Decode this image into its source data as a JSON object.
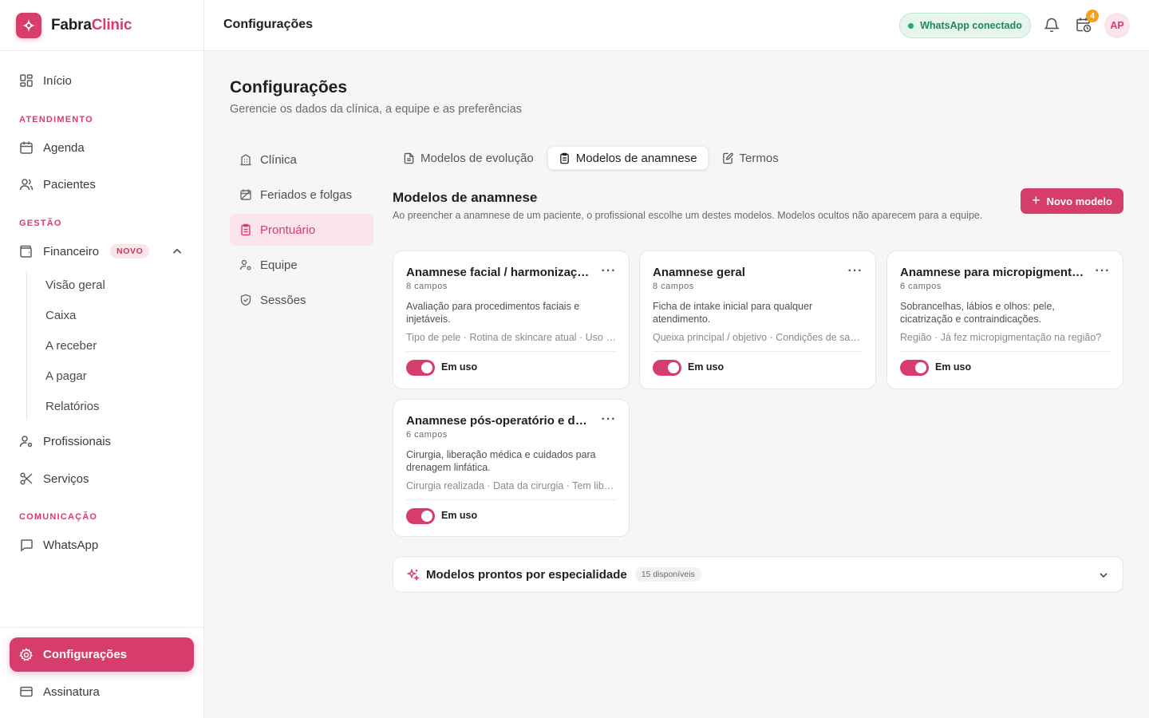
{
  "brand": {
    "name_part1": "Fabra",
    "name_part2": "Clinic"
  },
  "colors": {
    "accent": "#d63d6c",
    "accent_soft": "#fbe4ea",
    "success": "#1fae69",
    "warning": "#f59f1a"
  },
  "sidebar": {
    "home": "Início",
    "section_atendimento": "ATENDIMENTO",
    "agenda": "Agenda",
    "pacientes": "Pacientes",
    "section_gestao": "GESTÃO",
    "financeiro": "Financeiro",
    "financeiro_badge": "NOVO",
    "financeiro_sub": [
      "Visão geral",
      "Caixa",
      "A receber",
      "A pagar",
      "Relatórios"
    ],
    "profissionais": "Profissionais",
    "servicos": "Serviços",
    "section_comunicacao": "COMUNICAÇÃO",
    "whatsapp": "WhatsApp",
    "configuracoes": "Configurações",
    "assinatura": "Assinatura"
  },
  "topbar": {
    "title": "Configurações",
    "whatsapp_status": "WhatsApp conectado",
    "reminder_count": "4",
    "avatar_initials": "AP"
  },
  "page": {
    "title": "Configurações",
    "subtitle": "Gerencie os dados da clínica, a equipe e as preferências"
  },
  "settings_nav": [
    "Clínica",
    "Feriados e folgas",
    "Prontuário",
    "Equipe",
    "Sessões"
  ],
  "tabs": [
    "Modelos de evolução",
    "Modelos de anamnese",
    "Termos"
  ],
  "section": {
    "title": "Modelos de anamnese",
    "description": "Ao preencher a anamnese de um paciente, o profissional escolhe um destes modelos. Modelos ocultos não aparecem para a equipe.",
    "new_button": "Novo modelo"
  },
  "cards": [
    {
      "title": "Anamnese facial / harmonização facial",
      "count": "8 campos",
      "description": "Avaliação para procedimentos faciais e injetáveis.",
      "fields": "Tipo de pele · Rotina de skincare atual · Uso de ácidos",
      "toggle_label": "Em uso"
    },
    {
      "title": "Anamnese geral",
      "count": "8 campos",
      "description": "Ficha de intake inicial para qualquer atendimento.",
      "fields": "Queixa principal / objetivo · Condições de saúde",
      "toggle_label": "Em uso"
    },
    {
      "title": "Anamnese para micropigmentação",
      "count": "6 campos",
      "description": "Sobrancelhas, lábios e olhos: pele, cicatrização e contraindicações.",
      "fields": "Região · Já fez micropigmentação na região?",
      "toggle_label": "Em uso"
    },
    {
      "title": "Anamnese pós-operatório e drenagem",
      "count": "6 campos",
      "description": "Cirurgia, liberação médica e cuidados para drenagem linfática.",
      "fields": "Cirurgia realizada · Data da cirurgia · Tem liberação médica?",
      "toggle_label": "Em uso"
    }
  ],
  "ready_models": {
    "title": "Modelos prontos por especialidade",
    "badge": "15 disponíveis"
  }
}
